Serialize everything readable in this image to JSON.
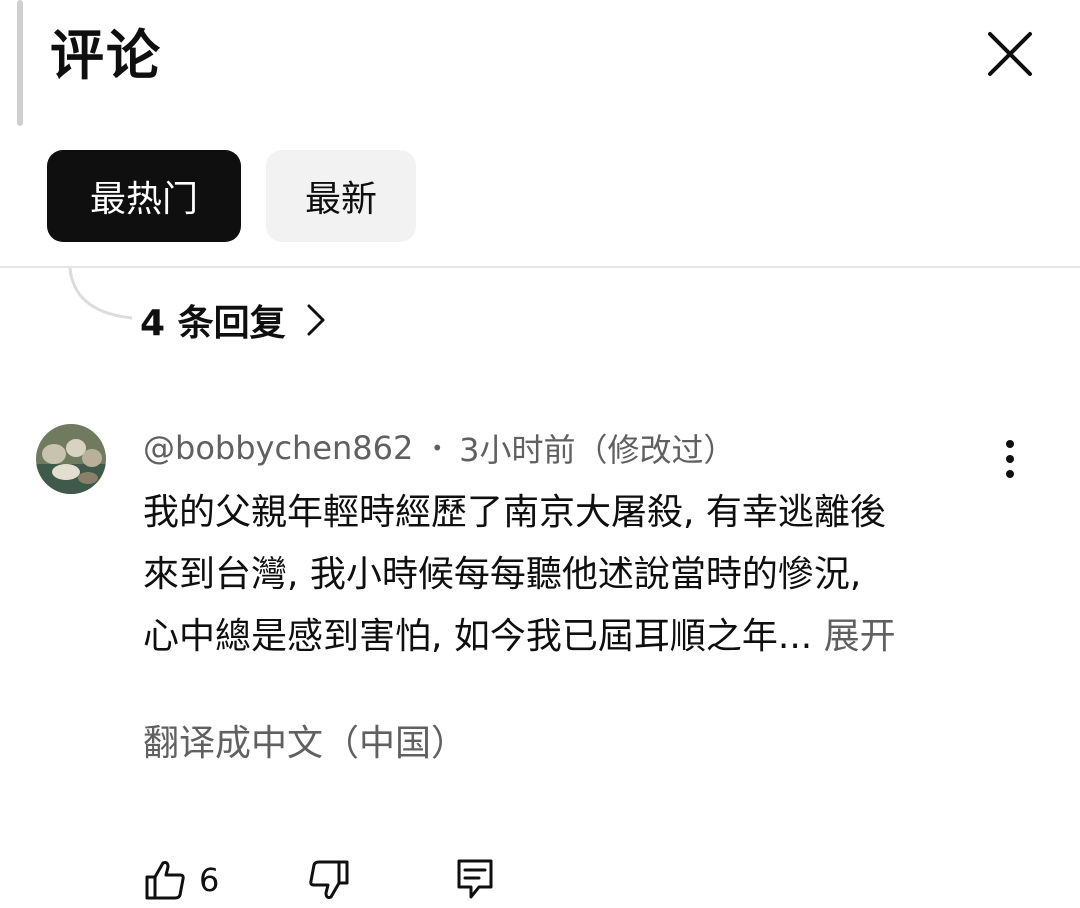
{
  "panel": {
    "title": "评论",
    "close_icon": "close-icon"
  },
  "sort_chips": [
    {
      "label": "最热门",
      "active": true
    },
    {
      "label": "最新",
      "active": false
    }
  ],
  "replies": {
    "label": "4 条回复",
    "chevron_icon": "chevron-right-icon"
  },
  "comment": {
    "author": "@bobbychen862",
    "separator": "•",
    "time": "3小时前（修改过）",
    "lines": [
      "我的父親年輕時經歷了南京大屠殺, 有幸逃離後",
      "來到台灣, 我小時候每每聽他述說當時的慘況,",
      "心中總是感到害怕, 如今我已屆耳順之年..."
    ],
    "expand_label": "展开",
    "translate_label": "翻译成中文（中国）",
    "like_count": "6",
    "icons": {
      "like": "thumbs-up-icon",
      "dislike": "thumbs-down-icon",
      "reply": "reply-comment-icon",
      "more": "more-vertical-icon"
    }
  },
  "colors": {
    "text_primary": "#0f0f0f",
    "text_secondary": "#606060",
    "chip_active_bg": "#0f0f0f",
    "chip_inactive_bg": "#f2f2f2",
    "divider": "#e6e6e6"
  }
}
